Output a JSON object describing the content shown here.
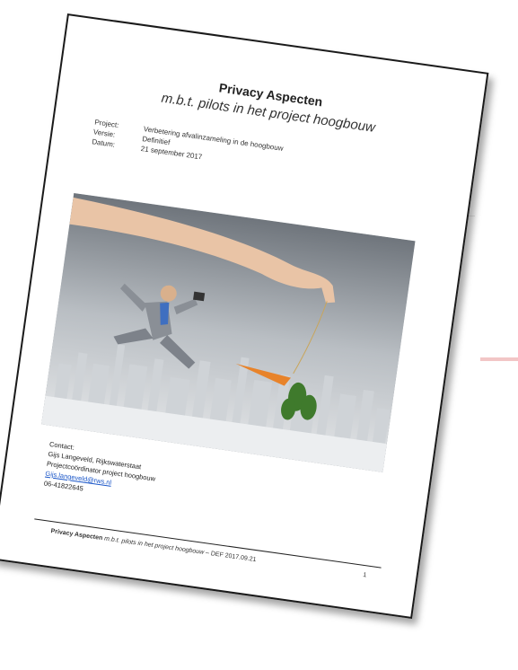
{
  "document": {
    "title": "Privacy Aspecten",
    "subtitle": "m.b.t. pilots in het project hoogbouw",
    "meta": [
      {
        "label": "Project:",
        "value": "Verbetering afvalinzameling in de hoogbouw"
      },
      {
        "label": "Versie:",
        "value": "Definitief"
      },
      {
        "label": "Datum:",
        "value": "21 september 2017"
      }
    ],
    "contact": {
      "heading": "Contact:",
      "name": "Gijs Langeveld, Rijkswaterstaat",
      "role": "Projectcoördinator project hoogbouw",
      "email": "Gijs.langeveld@rws.nl",
      "phone": "06-41822645"
    },
    "footer": {
      "bold": "Privacy Aspecten",
      "italic": "m.b.t. pilots in het project hoogbouw",
      "rest": "– DEF 2017.09.21",
      "page_number": "1"
    }
  },
  "colors": {
    "link": "#1a56c8",
    "carrot": "#e8832a",
    "suit": "#8a8f96"
  }
}
